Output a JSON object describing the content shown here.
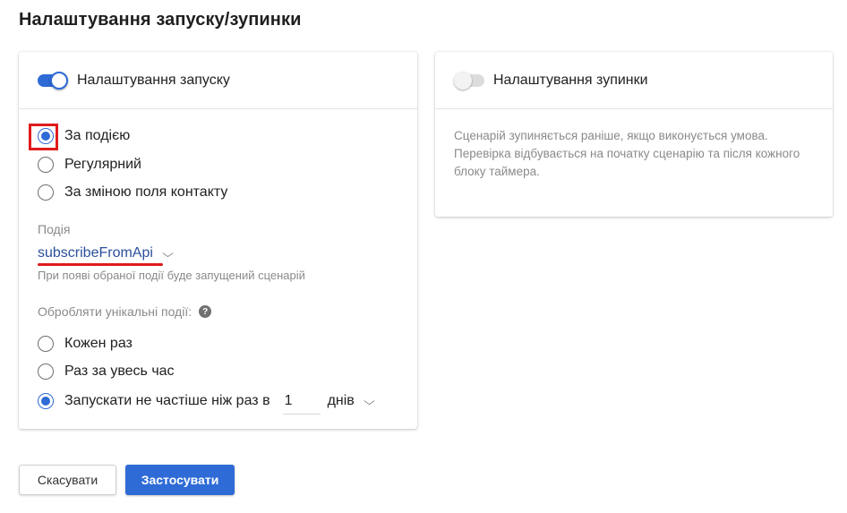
{
  "page_title": "Налаштування запуску/зупинки",
  "start_card": {
    "toggle_label": "Налаштування запуску",
    "toggle_on": true,
    "trigger_options": [
      {
        "label": "За подією",
        "checked": true
      },
      {
        "label": "Регулярний",
        "checked": false
      },
      {
        "label": "За зміною поля контакту",
        "checked": false
      }
    ],
    "event_field_label": "Подія",
    "event_value": "subscribeFromApi",
    "event_hint": "При появі обраної події буде запущений сценарій",
    "unique_label": "Обробляти унікальні події:",
    "unique_options": [
      {
        "label": "Кожен раз",
        "checked": false
      },
      {
        "label": "Раз за увесь час",
        "checked": false
      },
      {
        "label": "Запускати не частіше ніж раз в",
        "checked": true
      }
    ],
    "interval_value": "1",
    "interval_unit": "днів"
  },
  "stop_card": {
    "toggle_label": "Налаштування зупинки",
    "toggle_on": false,
    "description": "Сценарій зупиняється раніше, якщо виконується умова. Перевірка відбувається на початку сценарію та після кожного блоку таймера."
  },
  "buttons": {
    "cancel_label": "Скасувати",
    "apply_label": "Застосувати"
  },
  "colors": {
    "accent": "#2e6bd6",
    "highlight": "#e01b1b",
    "muted_text": "#8a8a8a"
  },
  "icons": {
    "help": "question-circle",
    "dropdown": "chevron-down"
  }
}
